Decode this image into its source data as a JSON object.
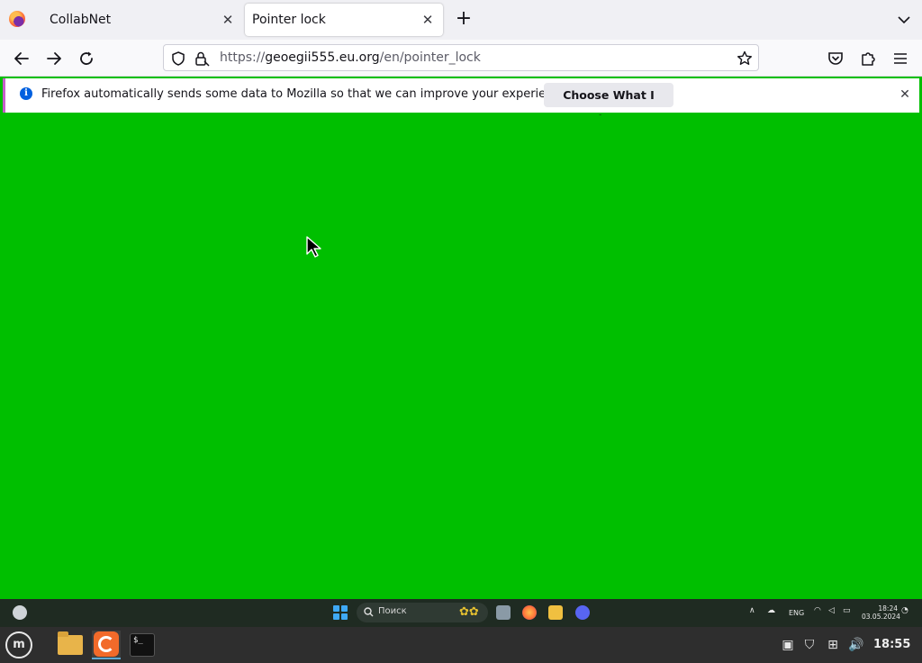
{
  "browser": {
    "tabs": [
      {
        "title": "CollabNet",
        "active": false
      },
      {
        "title": "Pointer lock",
        "active": true
      }
    ],
    "url": {
      "scheme": "https://",
      "domain": "geoegii555.eu.org",
      "path": "/en/pointer_lock"
    }
  },
  "notification": {
    "message": "Firefox automatically sends some data to Mozilla so that we can improve your experience.",
    "button_label": "Choose What I Share"
  },
  "page": {
    "background_color": "#00bf00"
  },
  "inner_taskbar": {
    "search_placeholder": "Поиск",
    "language": "ENG",
    "time": "18:24",
    "date": "03.05.2024"
  },
  "panel": {
    "clock": "18:55",
    "apps": [
      "files-icon",
      "firefox-icon",
      "terminal-icon"
    ]
  },
  "colors": {
    "accent": "#0060df",
    "notif_border": "#c45fc8",
    "panel_bg": "#2e2e2e"
  }
}
